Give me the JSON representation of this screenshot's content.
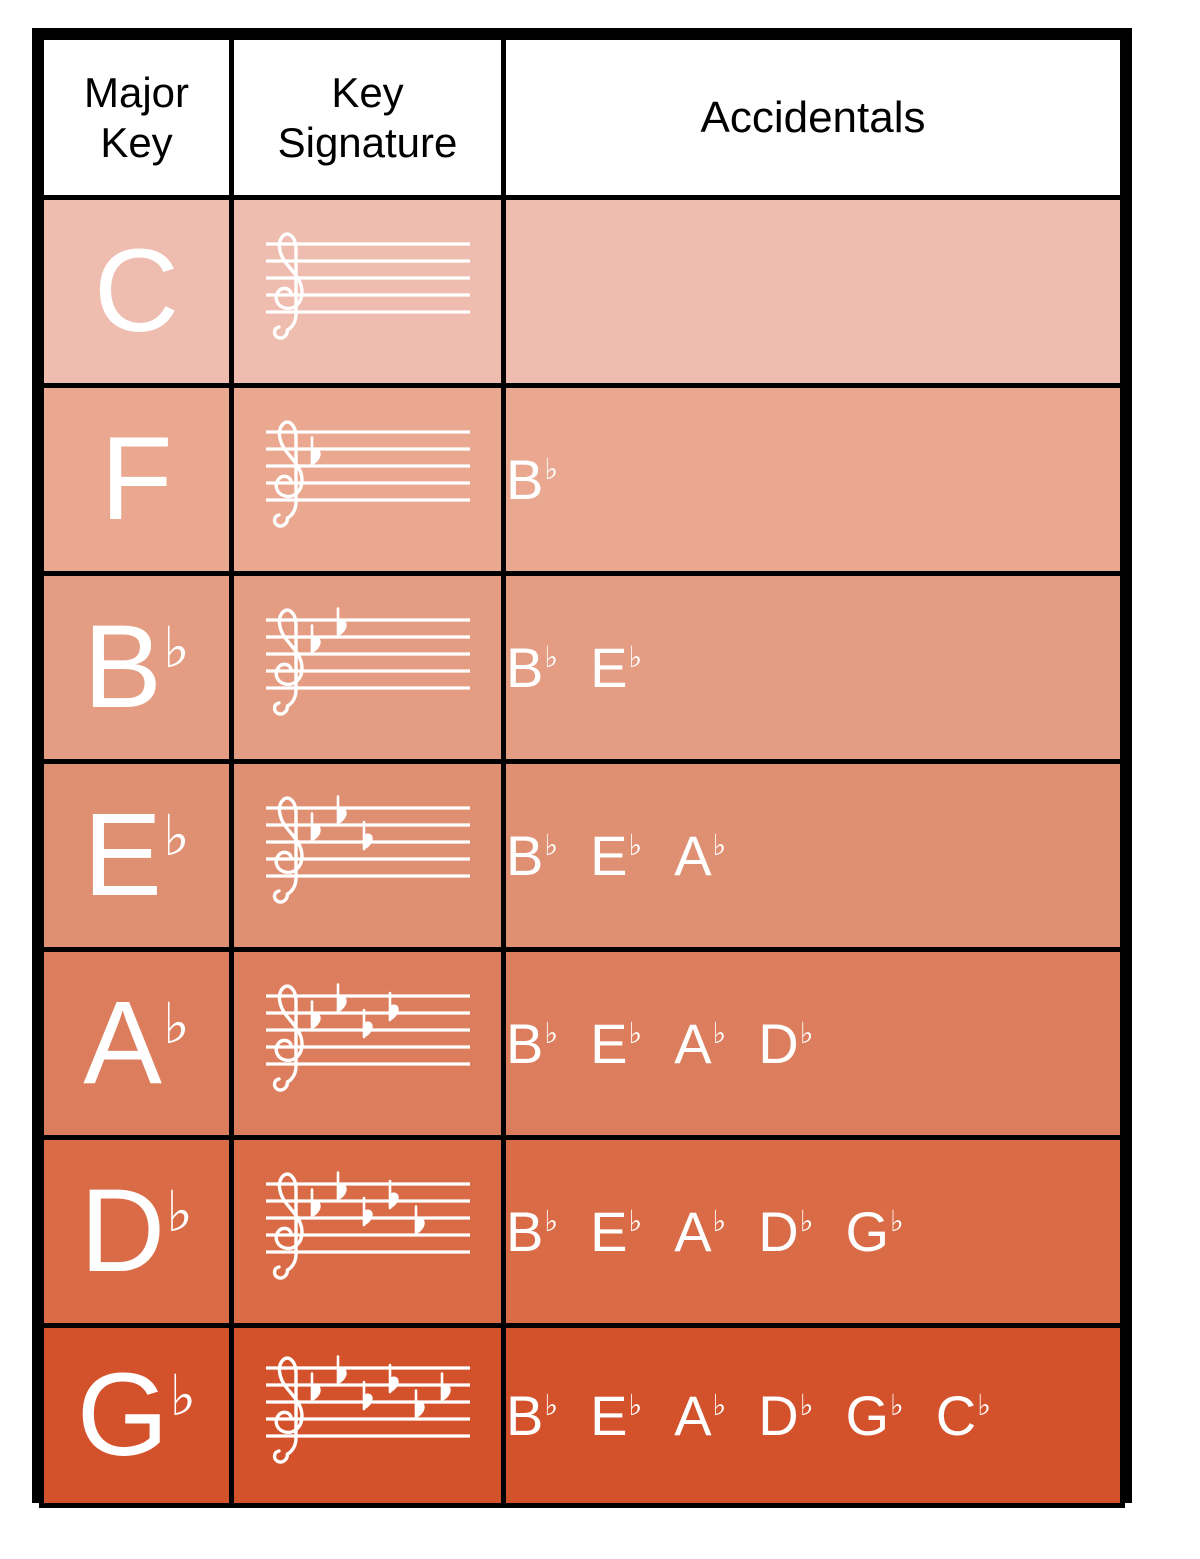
{
  "table": {
    "headers": {
      "major_key": "Major\nKey",
      "major_key_line1": "Major",
      "major_key_line2": "Key",
      "key_signature_line1": "Key",
      "key_signature_line2": "Signature",
      "accidentals": "Accidentals"
    },
    "flat_symbol": "♭",
    "clef_icon": "treble-clef-icon",
    "rows": [
      {
        "key_letter": "C",
        "key_has_flat": false,
        "key_label": "C",
        "num_flats": 0,
        "accidentals": [],
        "row_color": "#eebdaf"
      },
      {
        "key_letter": "F",
        "key_has_flat": false,
        "key_label": "F",
        "num_flats": 1,
        "accidentals": [
          {
            "letter": "B",
            "flat": true
          }
        ],
        "row_color": "#e9a88f"
      },
      {
        "key_letter": "B",
        "key_has_flat": true,
        "key_label": "B♭",
        "num_flats": 2,
        "accidentals": [
          {
            "letter": "B",
            "flat": true
          },
          {
            "letter": "E",
            "flat": true
          }
        ],
        "row_color": "#e49c82"
      },
      {
        "key_letter": "E",
        "key_has_flat": true,
        "key_label": "E♭",
        "num_flats": 3,
        "accidentals": [
          {
            "letter": "B",
            "flat": true
          },
          {
            "letter": "E",
            "flat": true
          },
          {
            "letter": "A",
            "flat": true
          }
        ],
        "row_color": "#df8f72"
      },
      {
        "key_letter": "A",
        "key_has_flat": true,
        "key_label": "A♭",
        "num_flats": 4,
        "accidentals": [
          {
            "letter": "B",
            "flat": true
          },
          {
            "letter": "E",
            "flat": true
          },
          {
            "letter": "A",
            "flat": true
          },
          {
            "letter": "D",
            "flat": true
          }
        ],
        "row_color": "#dc7e5d"
      },
      {
        "key_letter": "D",
        "key_has_flat": true,
        "key_label": "D♭",
        "num_flats": 5,
        "accidentals": [
          {
            "letter": "B",
            "flat": true
          },
          {
            "letter": "E",
            "flat": true
          },
          {
            "letter": "A",
            "flat": true
          },
          {
            "letter": "D",
            "flat": true
          },
          {
            "letter": "G",
            "flat": true
          }
        ],
        "row_color": "#d96c46"
      },
      {
        "key_letter": "G",
        "key_has_flat": true,
        "key_label": "G♭",
        "num_flats": 6,
        "accidentals": [
          {
            "letter": "B",
            "flat": true
          },
          {
            "letter": "E",
            "flat": true
          },
          {
            "letter": "A",
            "flat": true
          },
          {
            "letter": "D",
            "flat": true
          },
          {
            "letter": "G",
            "flat": true
          },
          {
            "letter": "C",
            "flat": true
          }
        ],
        "row_color": "#d3512b"
      }
    ]
  },
  "colors": {
    "border": "#000000",
    "header_bg": "#ffffff",
    "header_text": "#000000",
    "cell_text": "#ffffff",
    "page_bg": "#ffffff"
  }
}
